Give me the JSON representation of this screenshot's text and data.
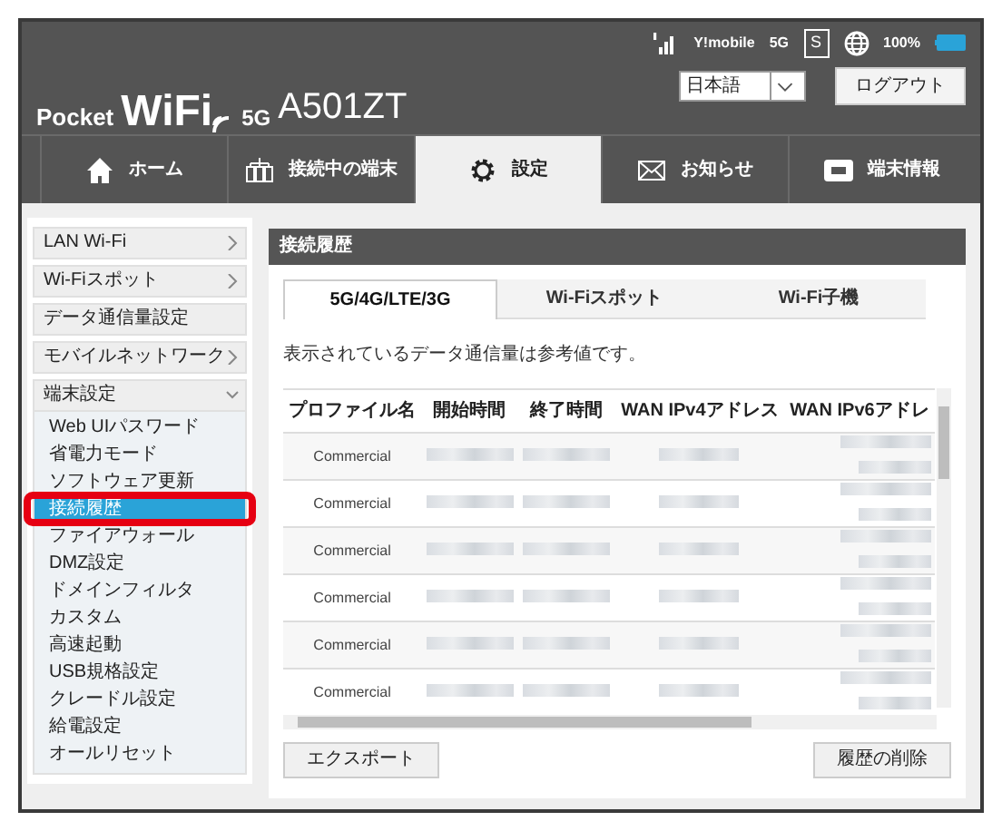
{
  "header": {
    "logo": {
      "brand": "Pocket",
      "wifi": "WiFi",
      "generation": "5G",
      "model": "A501ZT"
    },
    "status": {
      "carrier": "Y!mobile",
      "network": "5G",
      "sim": "S",
      "battery": "100%"
    },
    "language": "日本語",
    "logout": "ログアウト"
  },
  "nav": [
    {
      "label": "ホーム",
      "kind": "home",
      "selected": false
    },
    {
      "label": "接続中の端末",
      "kind": "devices",
      "selected": false
    },
    {
      "label": "設定",
      "kind": "settings",
      "selected": true
    },
    {
      "label": "お知らせ",
      "kind": "mail",
      "selected": false
    },
    {
      "label": "端末情報",
      "kind": "info",
      "selected": false
    }
  ],
  "sidebar": [
    {
      "label": "LAN Wi-Fi",
      "kind": "group",
      "expanded": false
    },
    {
      "label": "Wi-Fiスポット",
      "kind": "group",
      "expanded": false
    },
    {
      "label": "データ通信量設定",
      "kind": "link"
    },
    {
      "label": "モバイルネットワーク",
      "kind": "group",
      "expanded": false
    },
    {
      "label": "端末設定",
      "kind": "group",
      "expanded": true,
      "children": [
        {
          "label": "Web UIパスワード",
          "selected": false,
          "highlighted": false
        },
        {
          "label": "省電力モード",
          "selected": false,
          "highlighted": false
        },
        {
          "label": "ソフトウェア更新",
          "selected": false,
          "highlighted": false
        },
        {
          "label": "接続履歴",
          "selected": true,
          "highlighted": true
        },
        {
          "label": "ファイアウォール",
          "selected": false,
          "highlighted": false
        },
        {
          "label": "DMZ設定",
          "selected": false,
          "highlighted": false
        },
        {
          "label": "ドメインフィルタ",
          "selected": false,
          "highlighted": false
        },
        {
          "label": "カスタム",
          "selected": false,
          "highlighted": false
        },
        {
          "label": "高速起動",
          "selected": false,
          "highlighted": false
        },
        {
          "label": "USB規格設定",
          "selected": false,
          "highlighted": false
        },
        {
          "label": "クレードル設定",
          "selected": false,
          "highlighted": false
        },
        {
          "label": "給電設定",
          "selected": false,
          "highlighted": false
        },
        {
          "label": "オールリセット",
          "selected": false,
          "highlighted": false
        }
      ]
    }
  ],
  "panel": {
    "title": "接続履歴",
    "tabs": [
      {
        "label": "5G/4G/LTE/3G",
        "selected": true
      },
      {
        "label": "Wi-Fiスポット",
        "selected": false
      },
      {
        "label": "Wi-Fi子機",
        "selected": false
      }
    ],
    "note": "表示されているデータ通信量は参考値です。",
    "table": {
      "columns": [
        "プロファイル名",
        "開始時間",
        "終了時間",
        "WAN IPv4アドレス",
        "WAN IPv6アドレ"
      ],
      "rows": [
        {
          "profile": "Commercial"
        },
        {
          "profile": "Commercial"
        },
        {
          "profile": "Commercial"
        },
        {
          "profile": "Commercial"
        },
        {
          "profile": "Commercial"
        },
        {
          "profile": "Commercial"
        }
      ]
    },
    "buttons": [
      "エクスポート",
      "履歴の削除"
    ]
  }
}
